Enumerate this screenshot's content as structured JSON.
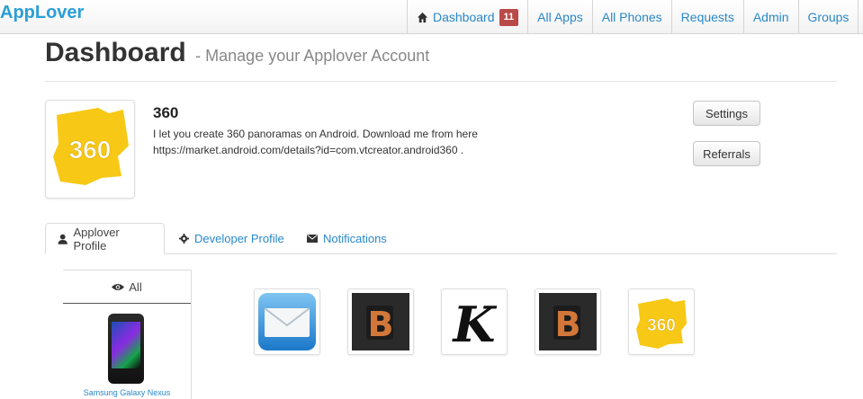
{
  "navbar": {
    "brand": "AppLover",
    "items": [
      {
        "label": "Dashboard",
        "badge": "11"
      },
      {
        "label": "All Apps"
      },
      {
        "label": "All Phones"
      },
      {
        "label": "Requests"
      },
      {
        "label": "Admin"
      },
      {
        "label": "Groups"
      }
    ],
    "avatar_icon": "360-app-icon"
  },
  "header": {
    "title": "Dashboard",
    "subtitle": "- Manage your Applover Account"
  },
  "profile": {
    "logo_icon": "360-app-icon",
    "name": "360",
    "description_line1": "I let you create 360 panoramas on Android. Download me from here",
    "description_line2": "https://market.android.com/details?id=com.vtcreator.android360 .",
    "settings_label": "Settings",
    "referrals_label": "Referrals"
  },
  "tabs": [
    {
      "label": "Applover Profile",
      "icon": "user-icon",
      "active": true
    },
    {
      "label": "Developer Profile",
      "icon": "gear-icon",
      "active": false
    },
    {
      "label": "Notifications",
      "icon": "envelope-icon",
      "active": false
    }
  ],
  "filter": {
    "all_label": "All",
    "phone_name": "Samsung Galaxy Nexus"
  },
  "apps": [
    {
      "icon": "mail-app-icon",
      "letter": ""
    },
    {
      "icon": "b-app-icon",
      "letter": "B"
    },
    {
      "icon": "k-app-icon",
      "letter": "K"
    },
    {
      "icon": "b-app-icon",
      "letter": "B"
    },
    {
      "icon": "360-app-icon",
      "letter": "360"
    }
  ],
  "colors": {
    "link": "#2a88c8",
    "brand": "#2a9fd6",
    "badge": "#b94a48",
    "logo_yellow": "#f7c815"
  }
}
